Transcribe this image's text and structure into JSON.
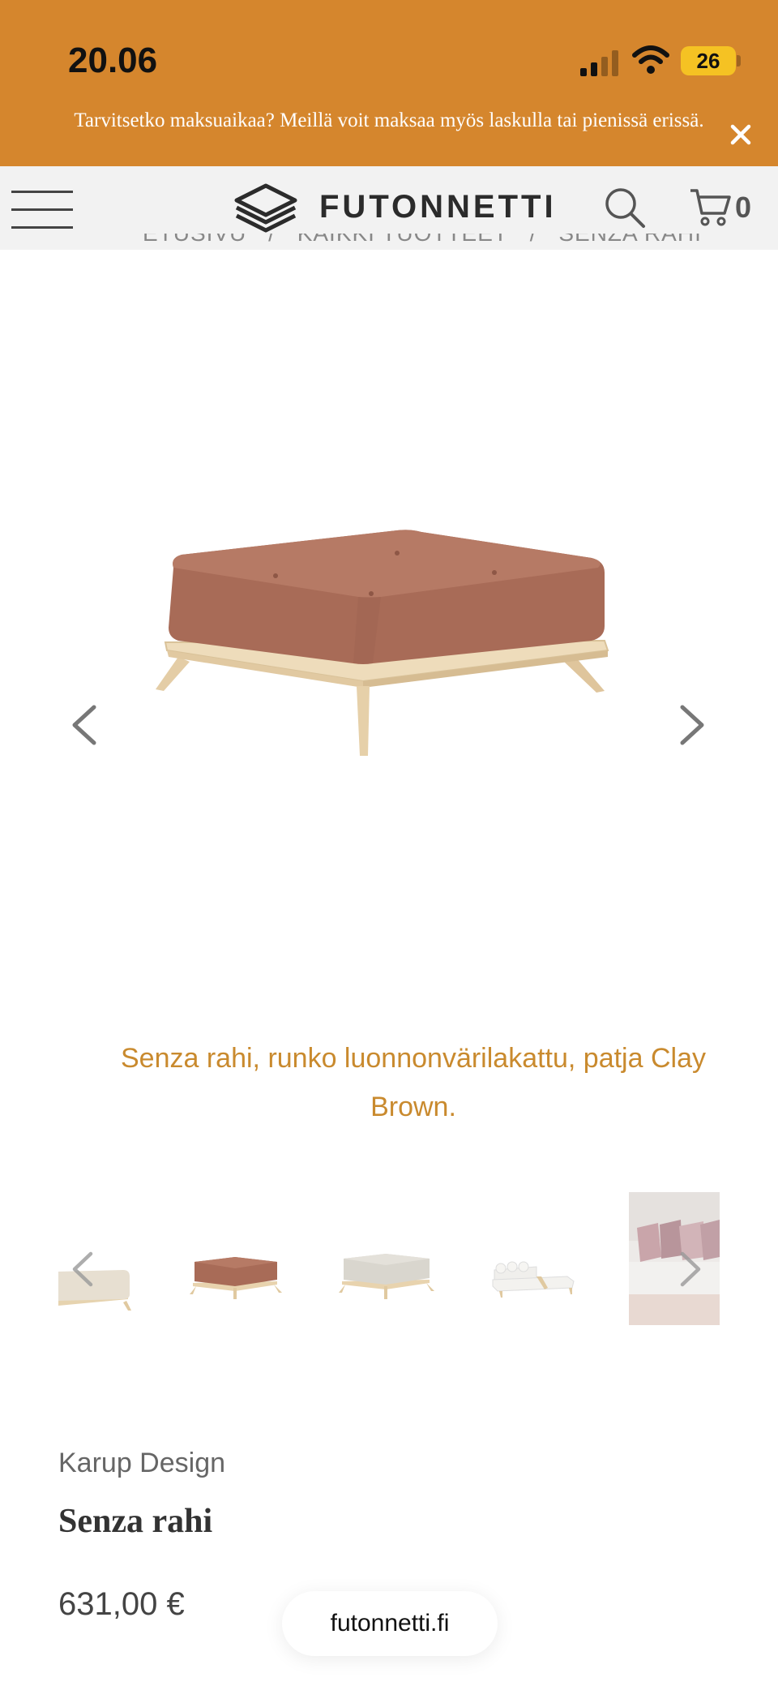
{
  "status_bar": {
    "time": "20.06",
    "battery": "26"
  },
  "banner": {
    "message": "Tarvitsetko maksuaikaa? Meillä voit maksaa myös laskulla tai pienissä erissä.",
    "close_icon": "close-icon"
  },
  "header": {
    "logo_text": "FUTONNETTI",
    "cart_count": "0",
    "icons": [
      "menu-icon",
      "search-icon",
      "cart-icon"
    ]
  },
  "breadcrumb": [
    "ETUSIVU",
    "/",
    "KAIKKI TUOTTEET",
    "/",
    "SENZA RAHI"
  ],
  "gallery": {
    "caption": "Senza rahi, runko luonnonvärilakattu, patja Clay Brown.",
    "thumbnails": [
      "natural ottoman",
      "clay brown ottoman",
      "grey ottoman",
      "white corner sofa",
      "sofa with cushions"
    ]
  },
  "product": {
    "brand": "Karup Design",
    "title": "Senza rahi",
    "price": "631,00 €"
  },
  "browser": {
    "url": "futonnetti.fi"
  },
  "colors": {
    "banner": "#D5862D",
    "caption": "#C98A2E",
    "cushion": "#A86B57",
    "wood": "#E8D2AE"
  }
}
